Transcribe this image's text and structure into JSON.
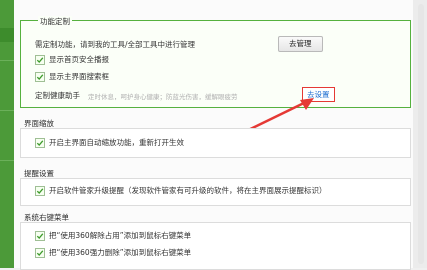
{
  "sections": {
    "feature_custom": {
      "title": "功能定制",
      "manage_text": "需定制功能，请到我的工具/全部工具中进行管理",
      "manage_button": "去管理",
      "options": [
        {
          "label": "显示首页安全播报",
          "checked": true
        },
        {
          "label": "显示主界面搜索框",
          "checked": true
        }
      ],
      "health": {
        "label": "定制健康助手",
        "desc": "定时休息，呵护身心健康；防蓝光伤害，缓解眼疲劳",
        "button": "去设置"
      }
    },
    "zoom": {
      "title": "界面缩放",
      "option": {
        "label": "开启主界面自动缩放功能，重新打开生效",
        "checked": true
      }
    },
    "reminder": {
      "title": "提醒设置",
      "option": {
        "label": "开启软件管家升级提醒（发现软件管家有可升级的软件，将在主界面展示提醒标识）",
        "checked": true
      }
    },
    "context_menu": {
      "title": "系统右键菜单",
      "options": [
        {
          "label": "把“使用360解除占用”添加到鼠标右键菜单",
          "checked": true
        },
        {
          "label": "把“使用360强力删除”添加到鼠标右键菜单",
          "checked": true
        }
      ]
    }
  },
  "colors": {
    "green": "#4c9a39",
    "highlight": "#e53935",
    "link": "#1f6fd1"
  }
}
